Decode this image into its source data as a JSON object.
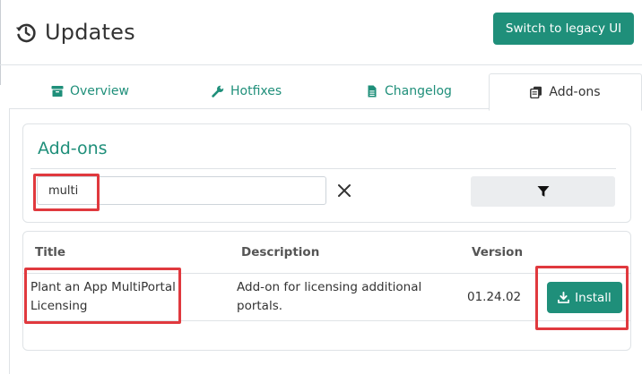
{
  "header": {
    "title": "Updates",
    "title_icon": "history-icon",
    "legacy_button_label": "Switch to legacy UI"
  },
  "tabs": [
    {
      "label": "Overview",
      "icon": "archive-icon",
      "active": false
    },
    {
      "label": "Hotfixes",
      "icon": "wrench-icon",
      "active": false
    },
    {
      "label": "Changelog",
      "icon": "file-icon",
      "active": false
    },
    {
      "label": "Add-ons",
      "icon": "copy-icon",
      "active": true
    }
  ],
  "addons": {
    "title": "Add-ons",
    "search": {
      "value": "multi",
      "clear_icon": "close-icon"
    },
    "filter_icon": "filter-icon"
  },
  "table": {
    "columns": [
      "Title",
      "Description",
      "Version"
    ],
    "rows": [
      {
        "title_line1": "Plant an App MultiPortal",
        "title_line2": "Licensing",
        "description_line1": "Add-on for licensing additional",
        "description_line2": "portals.",
        "version": "01.24.02",
        "action_label": "Install",
        "action_icon": "download-icon"
      }
    ]
  },
  "colors": {
    "accent": "#1f8f7a",
    "highlight": "#e0393e",
    "filter_button_bg": "#ebedef"
  }
}
